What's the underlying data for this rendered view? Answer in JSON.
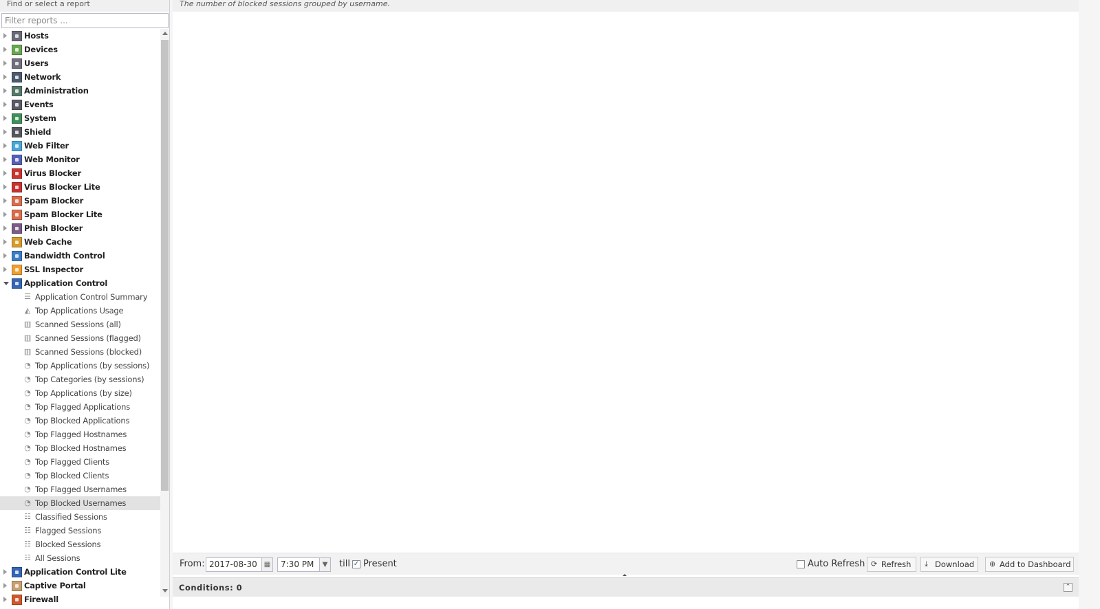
{
  "sidebar": {
    "header": "Find or select a report",
    "filter_placeholder": "Filter reports ...",
    "categories_top": [
      {
        "label": "Hosts",
        "color": "#6b6b7a"
      },
      {
        "label": "Devices",
        "color": "#6aa84f"
      },
      {
        "label": "Users",
        "color": "#6f6f7e"
      },
      {
        "label": "Network",
        "color": "#4b5a6e"
      },
      {
        "label": "Administration",
        "color": "#55796a"
      },
      {
        "label": "Events",
        "color": "#5a5a66"
      },
      {
        "label": "System",
        "color": "#3f8f5a"
      },
      {
        "label": "Shield",
        "color": "#56565f"
      },
      {
        "label": "Web Filter",
        "color": "#4aa6d8"
      },
      {
        "label": "Web Monitor",
        "color": "#5660b8"
      },
      {
        "label": "Virus Blocker",
        "color": "#c8332f"
      },
      {
        "label": "Virus Blocker Lite",
        "color": "#c8332f"
      },
      {
        "label": "Spam Blocker",
        "color": "#d96e4e"
      },
      {
        "label": "Spam Blocker Lite",
        "color": "#d96e4e"
      },
      {
        "label": "Phish Blocker",
        "color": "#7b5a86"
      },
      {
        "label": "Web Cache",
        "color": "#d79b2a"
      },
      {
        "label": "Bandwidth Control",
        "color": "#3b7ec6"
      },
      {
        "label": "SSL Inspector",
        "color": "#f0a030"
      }
    ],
    "expanded_category": {
      "label": "Application Control",
      "color": "#3565b5"
    },
    "reports": [
      {
        "label": "Application Control Summary",
        "icon": "text-icon",
        "glyph": "☰"
      },
      {
        "label": "Top Applications Usage",
        "icon": "area-chart-icon",
        "glyph": "◭"
      },
      {
        "label": "Scanned Sessions (all)",
        "icon": "bar-chart-icon",
        "glyph": "▥"
      },
      {
        "label": "Scanned Sessions (flagged)",
        "icon": "bar-chart-icon",
        "glyph": "▥"
      },
      {
        "label": "Scanned Sessions (blocked)",
        "icon": "bar-chart-icon",
        "glyph": "▥"
      },
      {
        "label": "Top Applications (by sessions)",
        "icon": "pie-chart-icon",
        "glyph": "◔"
      },
      {
        "label": "Top Categories (by sessions)",
        "icon": "pie-chart-icon",
        "glyph": "◔"
      },
      {
        "label": "Top Applications (by size)",
        "icon": "pie-chart-icon",
        "glyph": "◔"
      },
      {
        "label": "Top Flagged Applications",
        "icon": "pie-chart-icon",
        "glyph": "◔"
      },
      {
        "label": "Top Blocked Applications",
        "icon": "pie-chart-icon",
        "glyph": "◔"
      },
      {
        "label": "Top Flagged Hostnames",
        "icon": "pie-chart-icon",
        "glyph": "◔"
      },
      {
        "label": "Top Blocked Hostnames",
        "icon": "pie-chart-icon",
        "glyph": "◔"
      },
      {
        "label": "Top Flagged Clients",
        "icon": "pie-chart-icon",
        "glyph": "◔"
      },
      {
        "label": "Top Blocked Clients",
        "icon": "pie-chart-icon",
        "glyph": "◔"
      },
      {
        "label": "Top Flagged Usernames",
        "icon": "pie-chart-icon",
        "glyph": "◔"
      },
      {
        "label": "Top Blocked Usernames",
        "icon": "pie-chart-icon",
        "glyph": "◔",
        "selected": true
      },
      {
        "label": "Classified Sessions",
        "icon": "list-icon",
        "glyph": "☷"
      },
      {
        "label": "Flagged Sessions",
        "icon": "list-icon",
        "glyph": "☷"
      },
      {
        "label": "Blocked Sessions",
        "icon": "list-icon",
        "glyph": "☷"
      },
      {
        "label": "All Sessions",
        "icon": "list-icon",
        "glyph": "☷"
      }
    ],
    "categories_bottom": [
      {
        "label": "Application Control Lite",
        "color": "#3565b5"
      },
      {
        "label": "Captive Portal",
        "color": "#c9a070"
      },
      {
        "label": "Firewall",
        "color": "#d0582c"
      }
    ]
  },
  "main": {
    "description": "The number of blocked sessions grouped by username.",
    "toolbar": {
      "from_label": "From:",
      "date_value": "2017-08-30",
      "time_value": "7:30 PM",
      "till_label": "till",
      "present_label": "Present",
      "auto_refresh_label": "Auto Refresh",
      "refresh_label": "Refresh",
      "download_label": "Download",
      "add_dashboard_label": "Add to Dashboard"
    },
    "conditions_label": "Conditions: 0"
  }
}
